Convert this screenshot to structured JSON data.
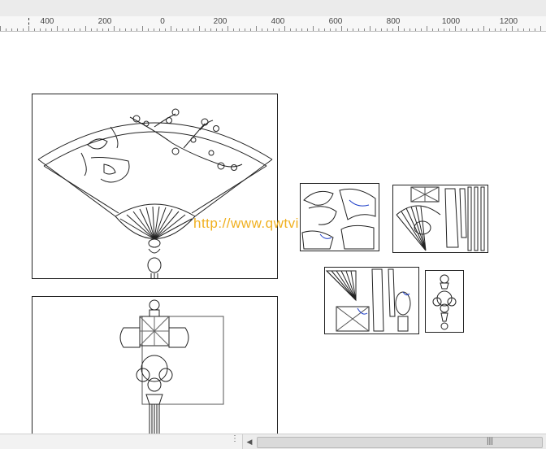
{
  "ruler": {
    "labels": [
      "400",
      "200",
      "0",
      "200",
      "400",
      "600",
      "800",
      "1000",
      "1200"
    ]
  },
  "canvas": {
    "watermark": "http://www.qwtvip.cn"
  },
  "scrollbar": {
    "grip": "|||"
  },
  "icons": {
    "scroll_left": "scroll-left-icon",
    "scroll_right": "scroll-right-icon"
  }
}
